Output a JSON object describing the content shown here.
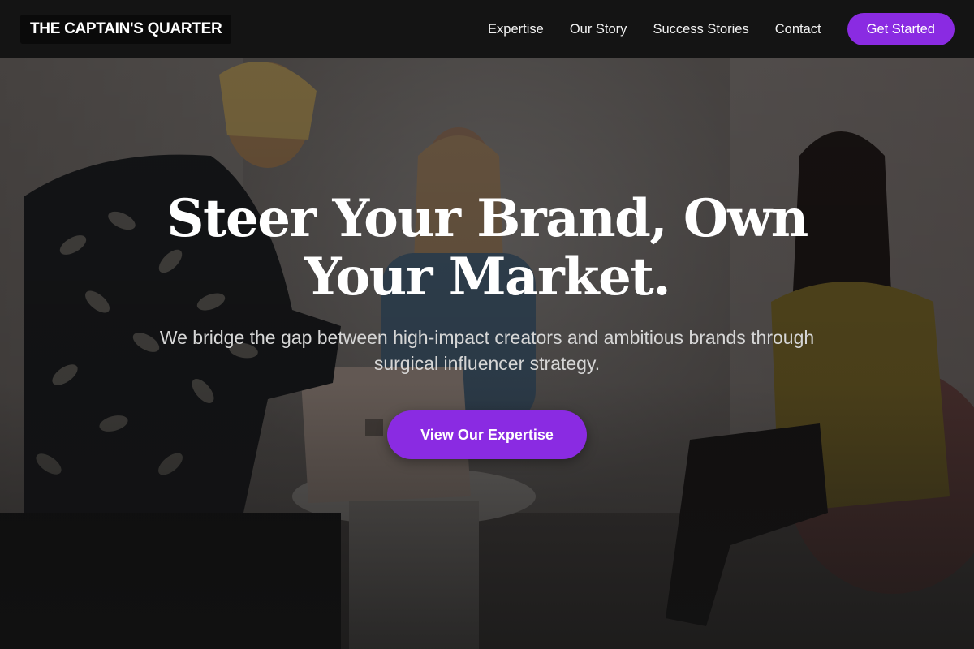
{
  "header": {
    "logo_text": "THE CAPTAIN'S QUARTER",
    "nav": [
      {
        "label": "Expertise"
      },
      {
        "label": "Our Story"
      },
      {
        "label": "Success Stories"
      },
      {
        "label": "Contact"
      }
    ],
    "cta_label": "Get Started"
  },
  "hero": {
    "title": "Steer Your Brand, Own Your Market.",
    "subtitle": "We bridge the gap between high-impact creators and ambitious brands through surgical influencer strategy.",
    "cta_label": "View Our Expertise"
  },
  "colors": {
    "accent": "#8a2be2",
    "header_bg": "#141414",
    "logo_bg": "#0a0a0a",
    "text_primary": "#ffffff",
    "text_secondary": "#d6d6d6"
  }
}
